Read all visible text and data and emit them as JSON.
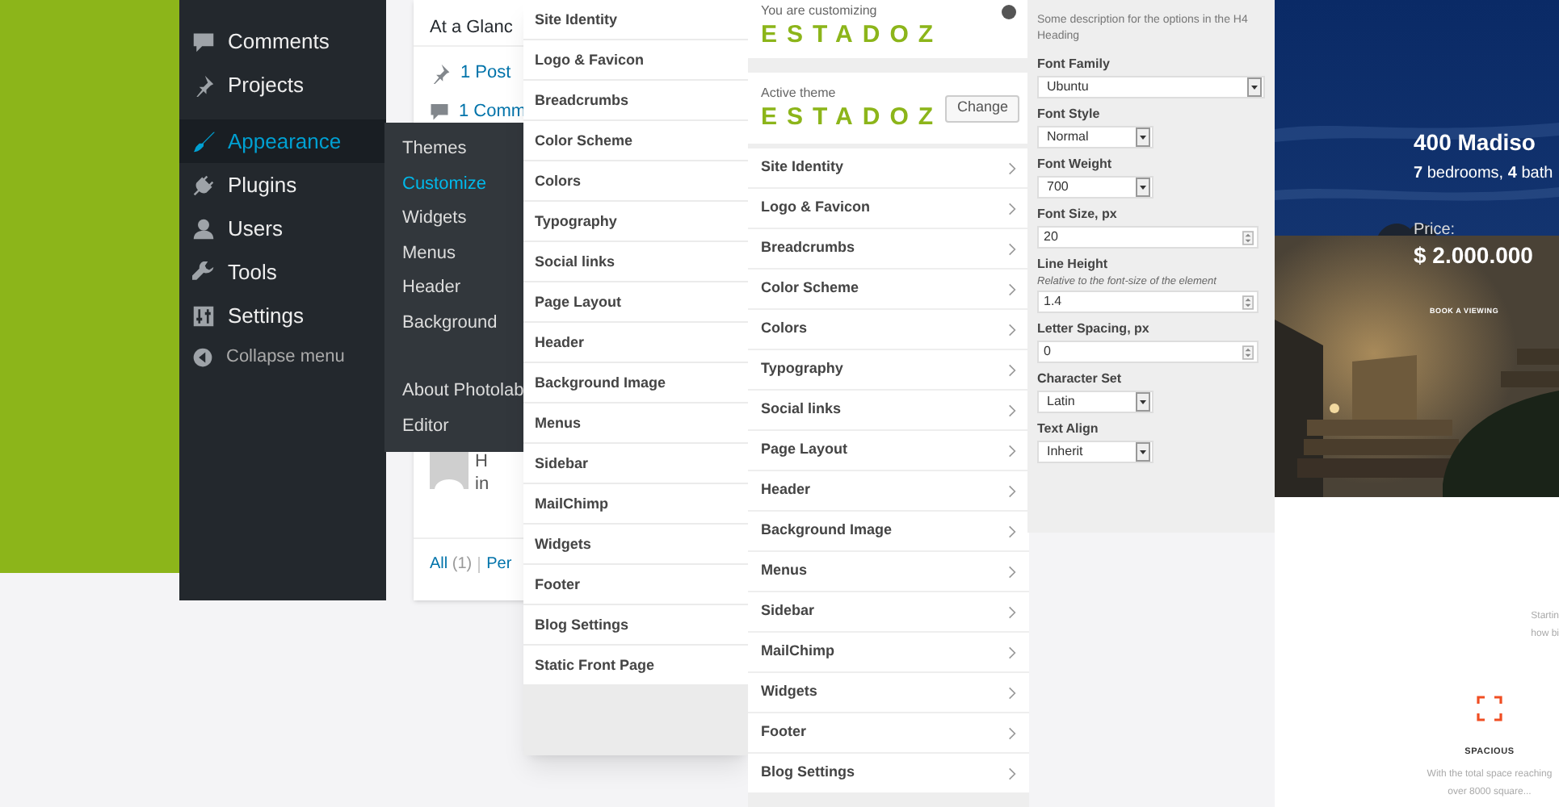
{
  "admin_menu": {
    "items": [
      {
        "label": "Comments",
        "selected": false
      },
      {
        "label": "Projects",
        "selected": false
      },
      {
        "label": "Appearance",
        "selected": true
      },
      {
        "label": "Plugins",
        "selected": false
      },
      {
        "label": "Users",
        "selected": false
      },
      {
        "label": "Tools",
        "selected": false
      },
      {
        "label": "Settings",
        "selected": false
      }
    ],
    "collapse": "Collapse menu"
  },
  "submenu": {
    "items": [
      {
        "label": "Themes",
        "selected": false
      },
      {
        "label": "Customize",
        "selected": true
      },
      {
        "label": "Widgets",
        "selected": false
      },
      {
        "label": "Menus",
        "selected": false
      },
      {
        "label": "Header",
        "selected": false
      },
      {
        "label": "Background",
        "selected": false
      }
    ],
    "extra_items": [
      {
        "label": "About Photolab",
        "selected": false
      },
      {
        "label": "Editor",
        "selected": false
      }
    ]
  },
  "dashboard": {
    "title": "At a Glanc",
    "stats": [
      "1 Post",
      "1 Comm"
    ],
    "comment_lines": [
      "H",
      "in"
    ],
    "filters": [
      {
        "label": "All",
        "count": "(1)"
      },
      {
        "label": "Per"
      }
    ]
  },
  "customizer_sections": [
    "Site Identity",
    "Logo & Favicon",
    "Breadcrumbs",
    "Color Scheme",
    "Colors",
    "Typography",
    "Social links",
    "Page Layout",
    "Header",
    "Background Image",
    "Menus",
    "Sidebar",
    "MailChimp",
    "Widgets",
    "Footer",
    "Blog Settings",
    "Static Front Page"
  ],
  "customizer": {
    "heading": "You are customizing",
    "site_title": "ESTADOZ",
    "active_theme_label": "Active theme",
    "theme_name": "ESTADOZ",
    "change_button": "Change",
    "sections": [
      "Site Identity",
      "Logo & Favicon",
      "Breadcrumbs",
      "Color Scheme",
      "Colors",
      "Typography",
      "Social links",
      "Page Layout",
      "Header",
      "Background Image",
      "Menus",
      "Sidebar",
      "MailChimp",
      "Widgets",
      "Footer",
      "Blog Settings"
    ]
  },
  "typography": {
    "description": "Some description for the options in the H4 Heading",
    "fields": [
      {
        "kind": "select",
        "label": "Font Family",
        "value": "Ubuntu"
      },
      {
        "kind": "select",
        "label": "Font Style",
        "value": "Normal"
      },
      {
        "kind": "select",
        "label": "Font Weight",
        "value": "700"
      },
      {
        "kind": "number",
        "label": "Font Size, px",
        "value": "20"
      },
      {
        "kind": "number",
        "label": "Line Height",
        "hint": "Relative to the font-size of the element",
        "value": "1.4"
      },
      {
        "kind": "number",
        "label": "Letter Spacing, px",
        "value": "0"
      },
      {
        "kind": "select",
        "label": "Character Set",
        "value": "Latin"
      },
      {
        "kind": "select",
        "label": "Text Align",
        "value": "Inherit"
      }
    ]
  },
  "preview": {
    "title": "400 Madiso",
    "specs": "**7** bedrooms, **4** bath",
    "price_label": "Price:",
    "price": "$ 2.000.000",
    "button": "BOOK A VIEWING",
    "intro_lines": [
      "Startin",
      "how bi"
    ],
    "feature": {
      "title": "SPACIOUS",
      "text": "With the total space reaching over 8000 square..."
    }
  }
}
